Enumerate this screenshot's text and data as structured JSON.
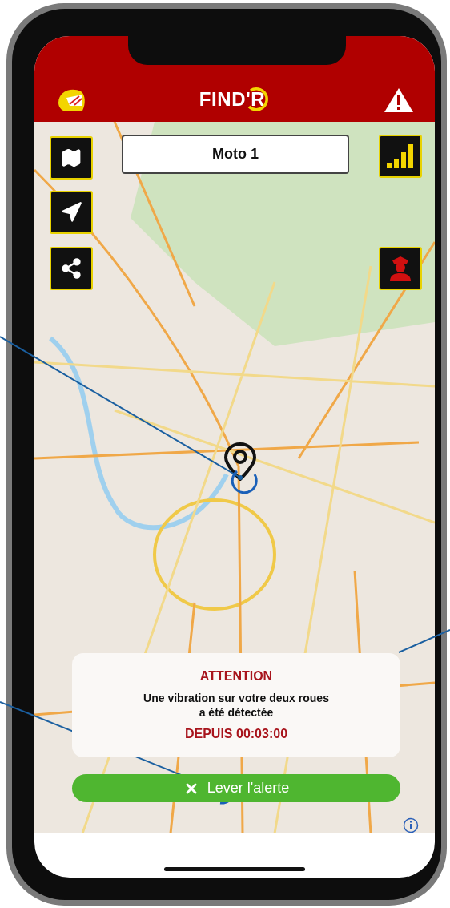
{
  "header": {
    "logo": "FIND'R"
  },
  "vehicle": {
    "value": "Moto 1"
  },
  "alert": {
    "title": "ATTENTION",
    "message_lines": [
      "Une vibration sur votre deux roues",
      "a été détectée"
    ],
    "timer": "DEPUIS 00:03:00"
  },
  "dismiss_button": {
    "label": "Lever l'alerte"
  }
}
